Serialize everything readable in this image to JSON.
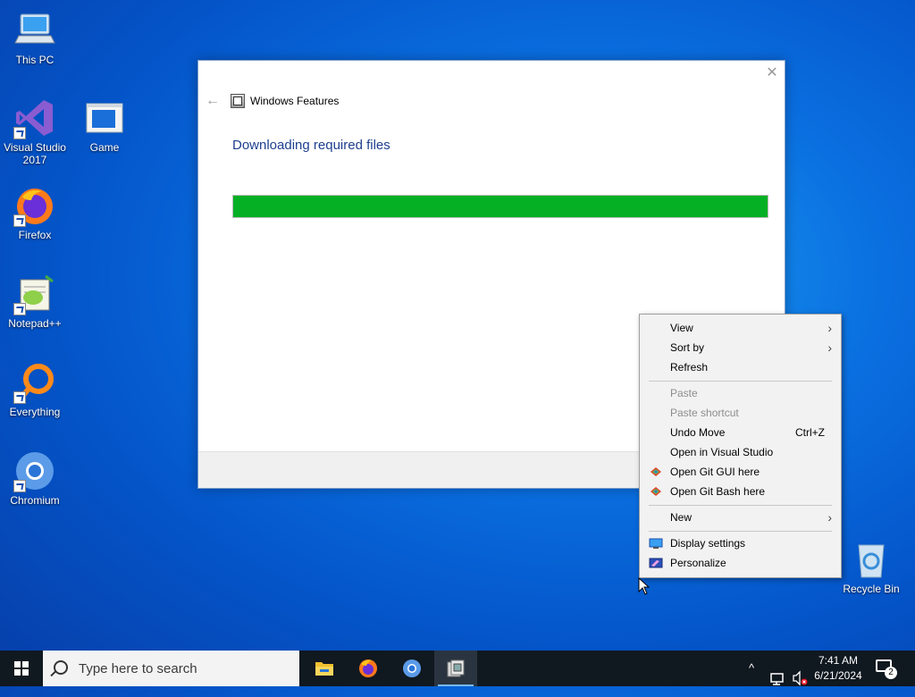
{
  "desktop": {
    "icons": [
      {
        "label": "This PC"
      },
      {
        "label": "Visual Studio 2017"
      },
      {
        "label": "Game"
      },
      {
        "label": "Firefox"
      },
      {
        "label": "Notepad++"
      },
      {
        "label": "Everything"
      },
      {
        "label": "Chromium"
      },
      {
        "label": "Recycle Bin"
      }
    ]
  },
  "dialog": {
    "title": "Windows Features",
    "heading": "Downloading required files",
    "progress_fraction": 1.0,
    "progress_color": "#06b025",
    "close_label": "✕",
    "back_label": "←"
  },
  "context_menu": {
    "items": [
      {
        "label": "View",
        "submenu": true
      },
      {
        "label": "Sort by",
        "submenu": true
      },
      {
        "label": "Refresh"
      },
      {
        "label": "Paste",
        "disabled": true
      },
      {
        "label": "Paste shortcut",
        "disabled": true
      },
      {
        "label": "Undo Move",
        "shortcut": "Ctrl+Z"
      },
      {
        "label": "Open in Visual Studio"
      },
      {
        "label": "Open Git GUI here",
        "icon": "git-icon"
      },
      {
        "label": "Open Git Bash here",
        "icon": "git-icon"
      },
      {
        "label": "New",
        "submenu": true
      },
      {
        "label": "Display settings",
        "icon": "display-icon"
      },
      {
        "label": "Personalize",
        "icon": "personalize-icon"
      }
    ],
    "submenu_arrow": "›"
  },
  "taskbar": {
    "search_placeholder": "Type here to search",
    "apps": [
      "file-explorer-icon",
      "firefox-icon",
      "chromium-icon",
      "windows-features-icon"
    ],
    "tray": {
      "chevron": "^",
      "time": "7:41 AM",
      "date": "6/21/2024",
      "notification_count": "2"
    }
  },
  "colors": {
    "accent": "#1e3f8f",
    "taskbar": "#101820",
    "progress": "#06b025"
  }
}
